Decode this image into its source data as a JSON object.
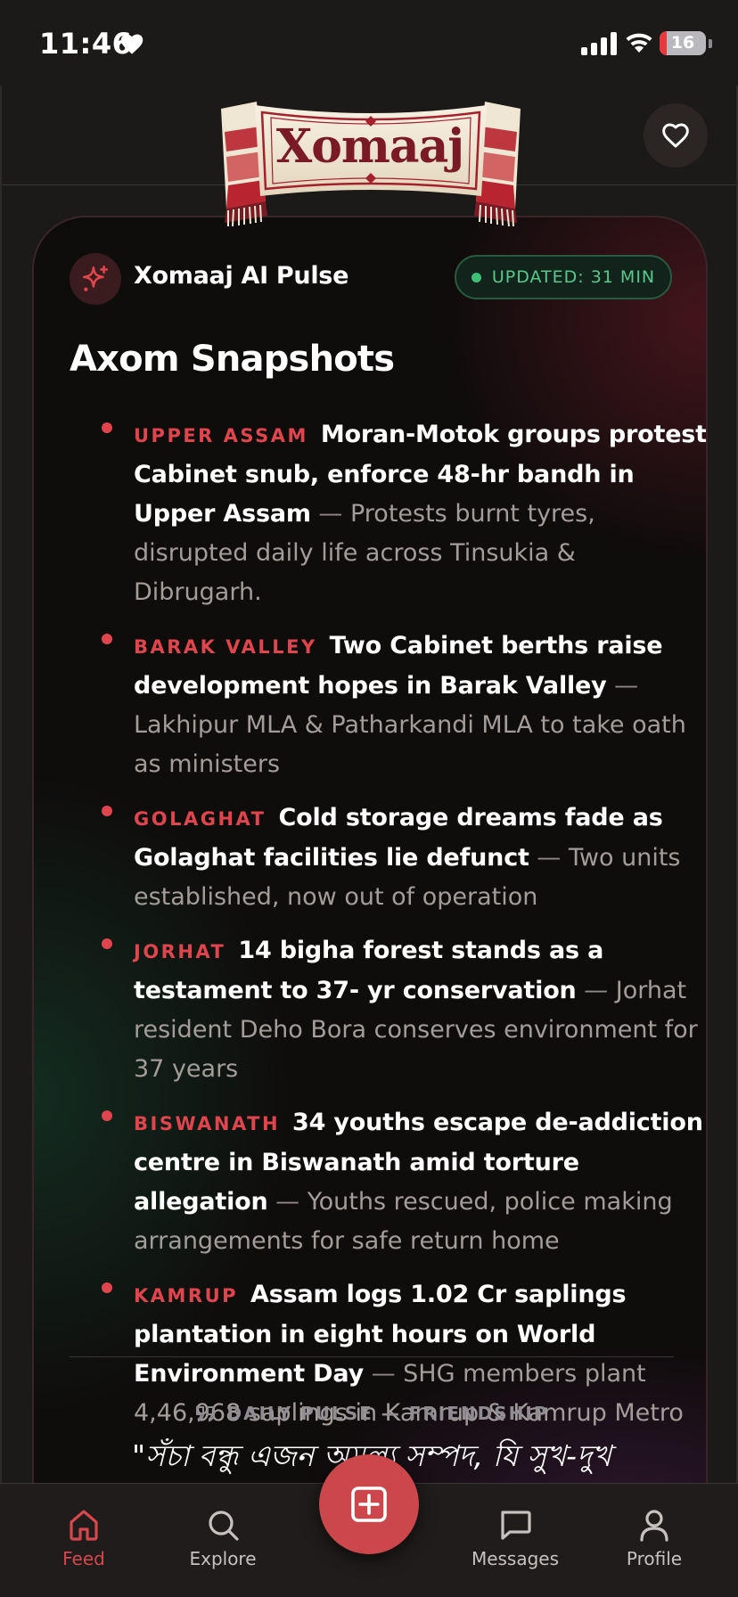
{
  "status_bar": {
    "time": "11:46",
    "battery": "16",
    "battery_level": 0.16
  },
  "header": {
    "brand": "Xomaaj"
  },
  "pulse": {
    "label": "Xomaaj AI Pulse",
    "updated": "UPDATED: 31 MIN",
    "section_title": "Axom Snapshots"
  },
  "snapshots": [
    {
      "region": "UPPER ASSAM",
      "headline": "Moran-Motok groups protest Cabinet snub, enforce 48-hr bandh in Upper Assam",
      "summary": "Protests burnt tyres, disrupted daily life across Tinsukia & Dibrugarh."
    },
    {
      "region": "BARAK VALLEY",
      "headline": "Two Cabinet berths raise development hopes in Barak Valley",
      "summary": "Lakhipur MLA & Patharkandi MLA to take oath as ministers"
    },
    {
      "region": "GOLAGHAT",
      "headline": "Cold storage dreams fade as Golaghat facilities lie defunct",
      "summary": "Two units established, now out of operation"
    },
    {
      "region": "JORHAT",
      "headline": "14 bigha forest stands as a testament to 37- yr conservation",
      "summary": "Jorhat resident Deho Bora conserves environment for 37 years"
    },
    {
      "region": "BISWANATH",
      "headline": "34 youths escape de-addiction centre in Biswanath amid torture allegation",
      "summary": "Youths rescued, police making arrangements for safe return home"
    },
    {
      "region": "KAMRUP",
      "headline": "Assam logs 1.02 Cr saplings plantation in eight hours on World Environment Day",
      "summary": "SHG members plant 4,46,968 saplings in Kamrup & Kamrup Metro"
    }
  ],
  "daily_pulse": {
    "label": "DAILY PULSE — FRIENDSHIP",
    "quote": "\"সঁচা বন্ধু এজন অমূল্য সম্পদ, যি সুখ-দুখ"
  },
  "nav": {
    "feed": "Feed",
    "explore": "Explore",
    "messages": "Messages",
    "profile": "Profile"
  },
  "colors": {
    "accent": "#cc474b",
    "region": "#e0454d",
    "updated": "#58c98a",
    "background": "#1c1a19"
  },
  "icons": [
    "heart-icon",
    "sparkle-icon",
    "quote-icon",
    "home-icon",
    "search-icon",
    "add-post-icon",
    "chat-bubble-icon",
    "user-icon"
  ]
}
